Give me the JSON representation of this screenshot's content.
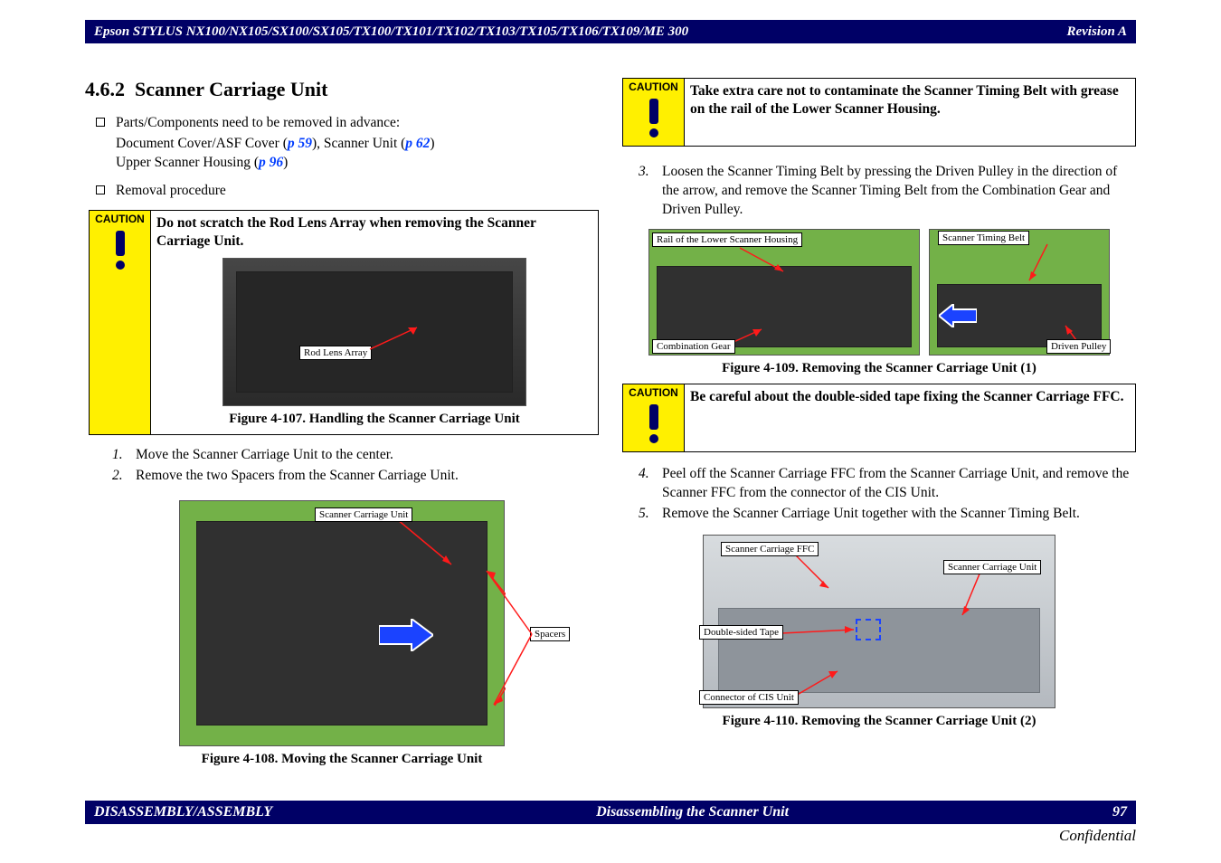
{
  "header": {
    "title": "Epson STYLUS NX100/NX105/SX100/SX105/TX100/TX101/TX102/TX103/TX105/TX106/TX109/ME 300",
    "revision": "Revision A"
  },
  "footer": {
    "left": "DISASSEMBLY/ASSEMBLY",
    "center": "Disassembling the Scanner Unit",
    "page": "97",
    "confidential": "Confidential"
  },
  "left": {
    "section_no": "4.6.2",
    "section_title": "Scanner Carriage Unit",
    "bullets": {
      "advance_label": "Parts/Components need to be removed in advance:",
      "advance_line_a": "Document Cover/ASF Cover (",
      "advance_link_a": "p 59",
      "advance_mid_a": "), Scanner Unit (",
      "advance_link_b": "p 62",
      "advance_end_a": ")",
      "advance_line_b_a": "Upper Scanner Housing (",
      "advance_link_c": "p 96",
      "advance_end_b": ")",
      "removal_label": "Removal procedure"
    },
    "caution1": "Do not scratch the Rod Lens Array when removing the Scanner Carriage Unit.",
    "fig107": {
      "callout_rod": "Rod Lens Array",
      "caption": "Figure 4-107.  Handling the Scanner Carriage Unit"
    },
    "steps": {
      "n1": "1.",
      "s1": "Move the Scanner Carriage Unit to the center.",
      "n2": "2.",
      "s2": "Remove the two Spacers from the Scanner Carriage Unit."
    },
    "fig108": {
      "callout_scu": "Scanner Carriage Unit",
      "callout_spacers": "Spacers",
      "caption": "Figure 4-108.  Moving the Scanner Carriage Unit"
    }
  },
  "right": {
    "caution2": "Take extra care not to contaminate the Scanner Timing Belt with grease on the rail of the Lower Scanner Housing.",
    "steps_a": {
      "n3": "3.",
      "s3": "Loosen the Scanner Timing Belt by pressing the Driven Pulley in the direction of the arrow, and remove the Scanner Timing Belt from the Combination Gear and Driven Pulley."
    },
    "fig109": {
      "callout_rail": "Rail of the Lower Scanner Housing",
      "callout_belt": "Scanner Timing Belt",
      "callout_gear": "Combination Gear",
      "callout_pulley": "Driven Pulley",
      "caption": "Figure 4-109.  Removing the Scanner Carriage Unit (1)"
    },
    "caution3": "Be careful about the double-sided tape fixing the Scanner Carriage FFC.",
    "steps_b": {
      "n4": "4.",
      "s4": "Peel off the Scanner Carriage FFC from the Scanner Carriage Unit, and remove the Scanner FFC from the connector of the CIS Unit.",
      "n5": "5.",
      "s5": "Remove the Scanner Carriage Unit together with the Scanner Timing Belt."
    },
    "fig110": {
      "callout_ffc": "Scanner Carriage FFC",
      "callout_scu": "Scanner Carriage Unit",
      "callout_tape": "Double-sided Tape",
      "callout_conn": "Connector of CIS Unit",
      "caption": "Figure 4-110.  Removing the Scanner Carriage Unit (2)"
    }
  },
  "caution_label": "CAUTION"
}
